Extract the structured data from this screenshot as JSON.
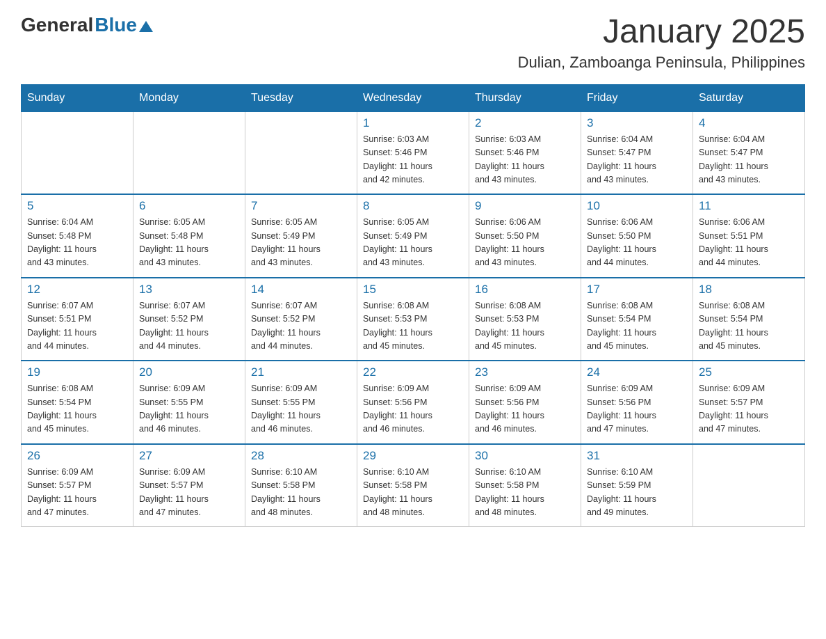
{
  "logo": {
    "text_general": "General",
    "text_blue": "Blue",
    "icon": "▲"
  },
  "title": "January 2025",
  "subtitle": "Dulian, Zamboanga Peninsula, Philippines",
  "days_of_week": [
    "Sunday",
    "Monday",
    "Tuesday",
    "Wednesday",
    "Thursday",
    "Friday",
    "Saturday"
  ],
  "weeks": [
    [
      {
        "day": "",
        "info": ""
      },
      {
        "day": "",
        "info": ""
      },
      {
        "day": "",
        "info": ""
      },
      {
        "day": "1",
        "info": "Sunrise: 6:03 AM\nSunset: 5:46 PM\nDaylight: 11 hours\nand 42 minutes."
      },
      {
        "day": "2",
        "info": "Sunrise: 6:03 AM\nSunset: 5:46 PM\nDaylight: 11 hours\nand 43 minutes."
      },
      {
        "day": "3",
        "info": "Sunrise: 6:04 AM\nSunset: 5:47 PM\nDaylight: 11 hours\nand 43 minutes."
      },
      {
        "day": "4",
        "info": "Sunrise: 6:04 AM\nSunset: 5:47 PM\nDaylight: 11 hours\nand 43 minutes."
      }
    ],
    [
      {
        "day": "5",
        "info": "Sunrise: 6:04 AM\nSunset: 5:48 PM\nDaylight: 11 hours\nand 43 minutes."
      },
      {
        "day": "6",
        "info": "Sunrise: 6:05 AM\nSunset: 5:48 PM\nDaylight: 11 hours\nand 43 minutes."
      },
      {
        "day": "7",
        "info": "Sunrise: 6:05 AM\nSunset: 5:49 PM\nDaylight: 11 hours\nand 43 minutes."
      },
      {
        "day": "8",
        "info": "Sunrise: 6:05 AM\nSunset: 5:49 PM\nDaylight: 11 hours\nand 43 minutes."
      },
      {
        "day": "9",
        "info": "Sunrise: 6:06 AM\nSunset: 5:50 PM\nDaylight: 11 hours\nand 43 minutes."
      },
      {
        "day": "10",
        "info": "Sunrise: 6:06 AM\nSunset: 5:50 PM\nDaylight: 11 hours\nand 44 minutes."
      },
      {
        "day": "11",
        "info": "Sunrise: 6:06 AM\nSunset: 5:51 PM\nDaylight: 11 hours\nand 44 minutes."
      }
    ],
    [
      {
        "day": "12",
        "info": "Sunrise: 6:07 AM\nSunset: 5:51 PM\nDaylight: 11 hours\nand 44 minutes."
      },
      {
        "day": "13",
        "info": "Sunrise: 6:07 AM\nSunset: 5:52 PM\nDaylight: 11 hours\nand 44 minutes."
      },
      {
        "day": "14",
        "info": "Sunrise: 6:07 AM\nSunset: 5:52 PM\nDaylight: 11 hours\nand 44 minutes."
      },
      {
        "day": "15",
        "info": "Sunrise: 6:08 AM\nSunset: 5:53 PM\nDaylight: 11 hours\nand 45 minutes."
      },
      {
        "day": "16",
        "info": "Sunrise: 6:08 AM\nSunset: 5:53 PM\nDaylight: 11 hours\nand 45 minutes."
      },
      {
        "day": "17",
        "info": "Sunrise: 6:08 AM\nSunset: 5:54 PM\nDaylight: 11 hours\nand 45 minutes."
      },
      {
        "day": "18",
        "info": "Sunrise: 6:08 AM\nSunset: 5:54 PM\nDaylight: 11 hours\nand 45 minutes."
      }
    ],
    [
      {
        "day": "19",
        "info": "Sunrise: 6:08 AM\nSunset: 5:54 PM\nDaylight: 11 hours\nand 45 minutes."
      },
      {
        "day": "20",
        "info": "Sunrise: 6:09 AM\nSunset: 5:55 PM\nDaylight: 11 hours\nand 46 minutes."
      },
      {
        "day": "21",
        "info": "Sunrise: 6:09 AM\nSunset: 5:55 PM\nDaylight: 11 hours\nand 46 minutes."
      },
      {
        "day": "22",
        "info": "Sunrise: 6:09 AM\nSunset: 5:56 PM\nDaylight: 11 hours\nand 46 minutes."
      },
      {
        "day": "23",
        "info": "Sunrise: 6:09 AM\nSunset: 5:56 PM\nDaylight: 11 hours\nand 46 minutes."
      },
      {
        "day": "24",
        "info": "Sunrise: 6:09 AM\nSunset: 5:56 PM\nDaylight: 11 hours\nand 47 minutes."
      },
      {
        "day": "25",
        "info": "Sunrise: 6:09 AM\nSunset: 5:57 PM\nDaylight: 11 hours\nand 47 minutes."
      }
    ],
    [
      {
        "day": "26",
        "info": "Sunrise: 6:09 AM\nSunset: 5:57 PM\nDaylight: 11 hours\nand 47 minutes."
      },
      {
        "day": "27",
        "info": "Sunrise: 6:09 AM\nSunset: 5:57 PM\nDaylight: 11 hours\nand 47 minutes."
      },
      {
        "day": "28",
        "info": "Sunrise: 6:10 AM\nSunset: 5:58 PM\nDaylight: 11 hours\nand 48 minutes."
      },
      {
        "day": "29",
        "info": "Sunrise: 6:10 AM\nSunset: 5:58 PM\nDaylight: 11 hours\nand 48 minutes."
      },
      {
        "day": "30",
        "info": "Sunrise: 6:10 AM\nSunset: 5:58 PM\nDaylight: 11 hours\nand 48 minutes."
      },
      {
        "day": "31",
        "info": "Sunrise: 6:10 AM\nSunset: 5:59 PM\nDaylight: 11 hours\nand 49 minutes."
      },
      {
        "day": "",
        "info": ""
      }
    ]
  ]
}
